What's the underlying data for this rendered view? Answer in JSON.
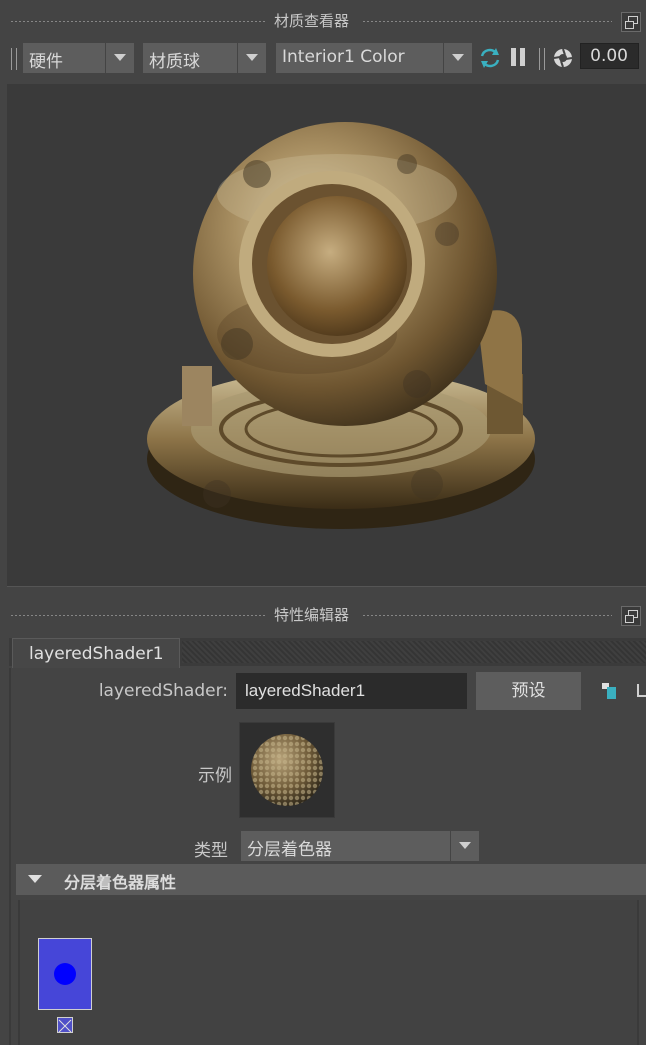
{
  "hypershade": {
    "title": "材质查看器",
    "renderer": "硬件",
    "geometry": "材质球",
    "environment": "Interior1 Color",
    "exposure": "0.00"
  },
  "attribute_editor": {
    "title": "特性编辑器",
    "tab": "layeredShader1",
    "node_type_label": "layeredShader:",
    "node_name": "layeredShader1",
    "preset_button": "预设",
    "sample_label": "示例",
    "type_label": "类型",
    "type_value": "分层着色器",
    "section_title": "分层着色器属性"
  },
  "colors": {
    "panel_bg": "#444444",
    "viewport_bg": "#3a3a3a",
    "field_bg": "#2b2b2b",
    "layer_swatch": "#4646d8",
    "accent_cyan": "#3ab0c0"
  }
}
